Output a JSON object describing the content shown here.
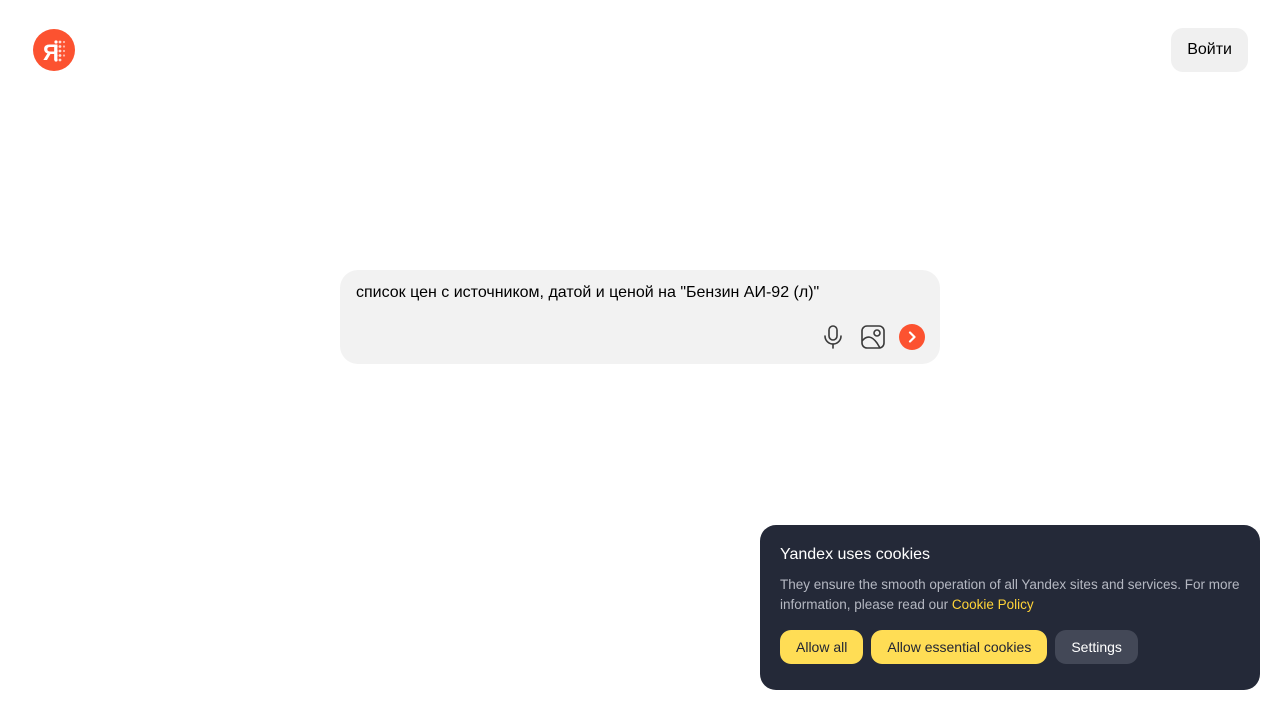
{
  "header": {
    "logo_icon": "yandex-logo-icon",
    "login_label": "Войти"
  },
  "search": {
    "query": "список цен с источником, датой и ценой на \"Бензин АИ-92 (л)\"",
    "icons": [
      "microphone-icon",
      "image-search-icon",
      "submit-arrow-icon"
    ]
  },
  "cookie_banner": {
    "title": "Yandex uses cookies",
    "description": "They ensure the smooth operation of all Yandex sites and services. For more information, please read our ",
    "policy_link": "Cookie Policy",
    "buttons": {
      "allow_all": "Allow all",
      "allow_essential": "Allow essential cookies",
      "settings": "Settings"
    }
  },
  "colors": {
    "brand": "#fc5230",
    "banner_bg": "#242938",
    "accent_yellow": "#ffdd55",
    "link_yellow": "#ffd338"
  }
}
